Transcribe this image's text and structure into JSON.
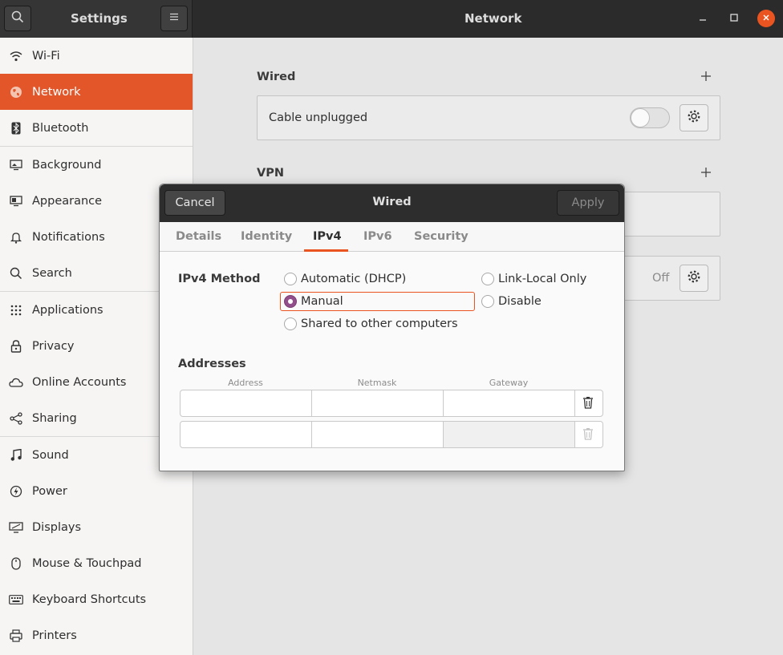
{
  "header": {
    "app_title": "Settings",
    "page_title": "Network",
    "search_icon": "search-icon",
    "menu_icon": "hamburger-menu-icon",
    "window_controls": [
      "minimize-icon",
      "maximize-icon",
      "close-icon"
    ]
  },
  "sidebar": {
    "active_index": 1,
    "items": [
      {
        "label": "Wi-Fi",
        "icon": "wifi-icon"
      },
      {
        "label": "Network",
        "icon": "network-globe-icon"
      },
      {
        "label": "Bluetooth",
        "icon": "bluetooth-icon"
      },
      {
        "label": "Background",
        "icon": "background-icon"
      },
      {
        "label": "Appearance",
        "icon": "appearance-icon"
      },
      {
        "label": "Notifications",
        "icon": "bell-icon"
      },
      {
        "label": "Search",
        "icon": "search-icon"
      },
      {
        "label": "Applications",
        "icon": "applications-grid-icon"
      },
      {
        "label": "Privacy",
        "icon": "lock-icon"
      },
      {
        "label": "Online Accounts",
        "icon": "cloud-icon"
      },
      {
        "label": "Sharing",
        "icon": "share-icon"
      },
      {
        "label": "Sound",
        "icon": "music-note-icon"
      },
      {
        "label": "Power",
        "icon": "power-icon"
      },
      {
        "label": "Displays",
        "icon": "display-icon"
      },
      {
        "label": "Mouse & Touchpad",
        "icon": "mouse-icon"
      },
      {
        "label": "Keyboard Shortcuts",
        "icon": "keyboard-icon"
      },
      {
        "label": "Printers",
        "icon": "printer-icon"
      }
    ]
  },
  "main": {
    "wired_title": "Wired",
    "wired_status": "Cable unplugged",
    "vpn_title": "VPN",
    "proxy_status": "Off"
  },
  "dialog": {
    "title": "Wired",
    "cancel_label": "Cancel",
    "apply_label": "Apply",
    "tabs": [
      "Details",
      "Identity",
      "IPv4",
      "IPv6",
      "Security"
    ],
    "active_tab": "IPv4",
    "method_label": "IPv4 Method",
    "methods": {
      "automatic": "Automatic (DHCP)",
      "manual": "Manual",
      "shared": "Shared to other computers",
      "link_local": "Link-Local Only",
      "disable": "Disable"
    },
    "selected_method": "Manual",
    "addresses_label": "Addresses",
    "columns": [
      "Address",
      "Netmask",
      "Gateway"
    ],
    "rows": [
      {
        "address": "",
        "netmask": "",
        "gateway": ""
      },
      {
        "address": "",
        "netmask": "",
        "gateway": ""
      }
    ]
  },
  "colors": {
    "accent": "#e95420",
    "radio_checked": "#924d8b",
    "header_dark": "#2b2b2b"
  }
}
